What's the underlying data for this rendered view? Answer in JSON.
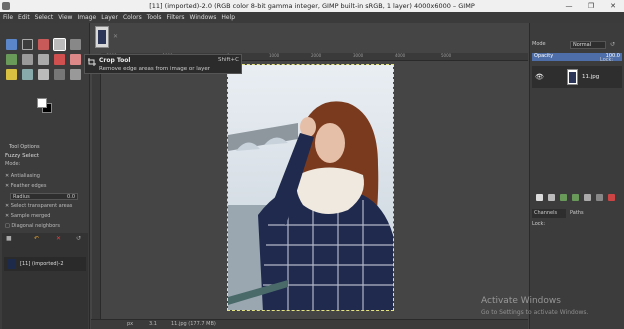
{
  "window": {
    "title": "[11] (imported)-2.0 (RGB color 8-bit gamma integer, GIMP built-in sRGB, 1 layer) 4000x6000 – GIMP",
    "min_glyph": "—",
    "max_glyph": "❐",
    "close_glyph": "✕"
  },
  "menu": [
    "File",
    "Edit",
    "Select",
    "View",
    "Image",
    "Layer",
    "Colors",
    "Tools",
    "Filters",
    "Windows",
    "Help"
  ],
  "tooltip": {
    "title": "Crop Tool",
    "shortcut": "Shift+C",
    "description": "Remove edge areas from image or layer"
  },
  "tool_options": {
    "tab_label": "Tool Options",
    "tool_name": "Fuzzy Select",
    "mode_label": "Mode:",
    "antialiasing": "Antialiasing",
    "feather_edges": "Feather edges",
    "radius_label": "Radius",
    "radius_value": "0.0",
    "select_transparent": "Select transparent areas",
    "sample_merged": "Sample merged",
    "diagonal_neighbors": "Diagonal neighbors"
  },
  "images_panel": {
    "item_label": "[11] (imported)-2"
  },
  "ruler": {
    "ticks": [
      "-2000",
      "-1000",
      "0",
      "1000",
      "2000",
      "3000",
      "4000",
      "5000"
    ]
  },
  "status": {
    "units": "px",
    "zoom": "3.1",
    "info": "11.jpg (177.7 MB)"
  },
  "layers": {
    "mode_label": "Mode",
    "mode_value": "Normal",
    "lock_label": "Lock:",
    "opacity_label": "Opacity",
    "opacity_value": "100.0",
    "layer_name": "11.jpg"
  },
  "dock_tabs": [
    "Channels",
    "Paths"
  ],
  "watermark": {
    "line1": "Activate Windows",
    "line2": "Go to Settings to activate Windows."
  },
  "colors": {
    "accent": "#4d6ea8",
    "canvas_bg": "#454545",
    "panel_bg": "#3c3c3c"
  }
}
